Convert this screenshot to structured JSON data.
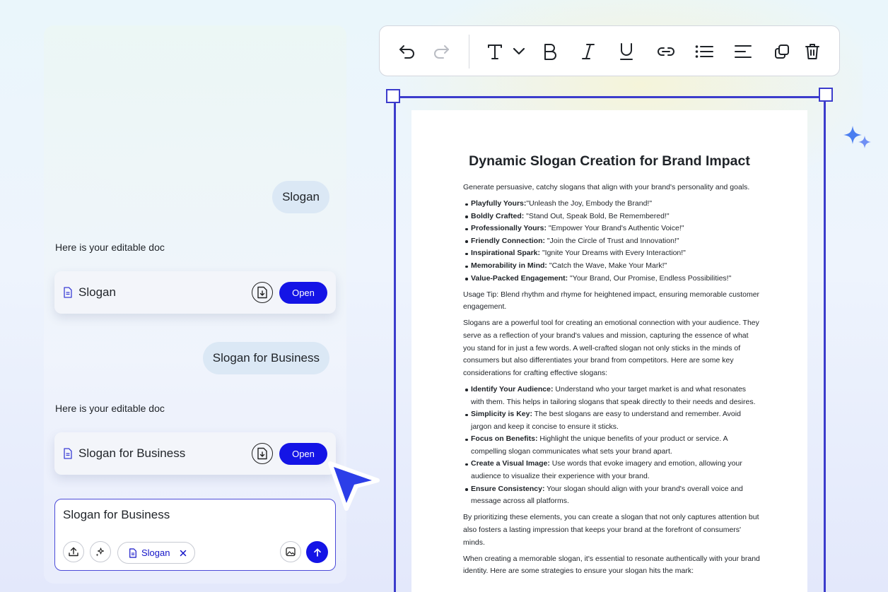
{
  "chat": {
    "messages": [
      {
        "role": "user",
        "text": "Slogan"
      },
      {
        "role": "assistant",
        "text": "Here is your editable doc",
        "doc_title": "Slogan",
        "open_label": "Open"
      },
      {
        "role": "user",
        "text": "Slogan for Business"
      },
      {
        "role": "assistant",
        "text": "Here is your editable doc",
        "doc_title": "Slogan for Business",
        "open_label": "Open"
      }
    ],
    "composer": {
      "value": "Slogan for Business",
      "attachment_chip": "Slogan"
    }
  },
  "toolbar": {
    "tools": [
      "undo-icon",
      "redo-icon",
      "text-style-icon",
      "chevron-down-icon",
      "bold-icon",
      "italic-icon",
      "underline-icon",
      "link-icon",
      "bullet-list-icon",
      "align-icon",
      "copy-icon",
      "delete-icon"
    ]
  },
  "colors": {
    "accent": "#1414e6",
    "frame": "#3c3ccc",
    "bubble": "#dbe8f5"
  },
  "document": {
    "title": "Dynamic Slogan Creation for Brand Impact",
    "intro": "Generate persuasive, catchy slogans that align with your brand's personality and goals.",
    "slogans": [
      {
        "label": "Playfully Yours:",
        "text": "\"Unleash the Joy, Embody the Brand!\""
      },
      {
        "label": "Boldly Crafted:",
        "text": " \"Stand Out, Speak Bold, Be Remembered!\""
      },
      {
        "label": "Professionally Yours:",
        "text": " \"Empower Your Brand's Authentic Voice!\""
      },
      {
        "label": "Friendly Connection:",
        "text": " \"Join the Circle of Trust and Innovation!\""
      },
      {
        "label": "Inspirational Spark:",
        "text": " \"Ignite Your Dreams with Every Interaction!\""
      },
      {
        "label": "Memorability in Mind:",
        "text": " \"Catch the Wave, Make Your Mark!\""
      },
      {
        "label": "Value-Packed Engagement:",
        "text": " \"Your Brand, Our Promise, Endless Possibilities!\""
      }
    ],
    "usage_tip": "Usage Tip: Blend rhythm and rhyme for heightened impact, ensuring memorable customer engagement.",
    "para1": "Slogans are a powerful tool for creating an emotional connection with your audience. They serve as a reflection of your brand's values and mission, capturing the essence of what you stand for in just a few words. A well-crafted slogan not only sticks in the minds of consumers but also differentiates your brand from competitors. Here are some key considerations for crafting effective slogans:",
    "considerations": [
      {
        "label": "Identify Your Audience:",
        "text": " Understand who your target market is and what resonates with them. This helps in tailoring slogans that speak directly to their needs and desires."
      },
      {
        "label": "Simplicity is Key:",
        "text": " The best slogans are easy to understand and remember. Avoid jargon and keep it concise to ensure it sticks."
      },
      {
        "label": "Focus on Benefits:",
        "text": " Highlight the unique benefits of your product or service. A compelling slogan communicates what sets your brand apart."
      },
      {
        "label": "Create a Visual Image:",
        "text": " Use words that evoke imagery and emotion, allowing your audience to visualize their experience with your brand."
      },
      {
        "label": "Ensure Consistency:",
        "text": " Your slogan should align with your brand's overall voice and message across all platforms."
      }
    ],
    "para2": "By prioritizing these elements, you can create a slogan that not only captures attention but also fosters a lasting impression that keeps your brand at the forefront of consumers' minds.",
    "para3": "When creating a memorable slogan, it's essential to resonate authentically with your brand identity. Here are some strategies to ensure your slogan hits the mark:"
  }
}
